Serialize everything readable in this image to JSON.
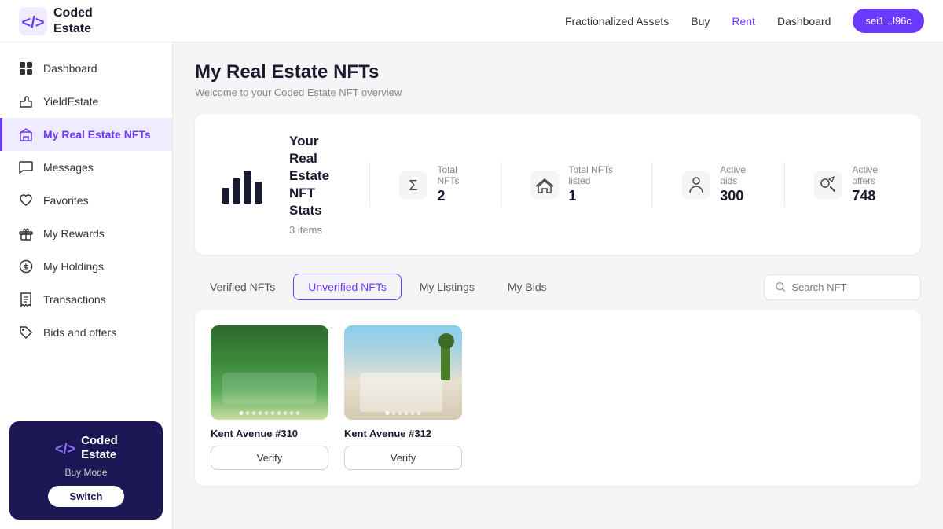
{
  "topnav": {
    "logo_text": "Coded\nEstate",
    "links": [
      {
        "label": "Fractionalized Assets",
        "active": false
      },
      {
        "label": "Buy",
        "active": false
      },
      {
        "label": "Rent",
        "active": true
      },
      {
        "label": "Dashboard",
        "active": false
      }
    ],
    "wallet": "sei1...l96c"
  },
  "sidebar": {
    "items": [
      {
        "id": "dashboard",
        "label": "Dashboard",
        "icon": "grid"
      },
      {
        "id": "yieldestate",
        "label": "YieldEstate",
        "icon": "puzzle"
      },
      {
        "id": "my-nfts",
        "label": "My Real Estate NFTs",
        "icon": "building",
        "active": true
      },
      {
        "id": "messages",
        "label": "Messages",
        "icon": "chat"
      },
      {
        "id": "favorites",
        "label": "Favorites",
        "icon": "heart"
      },
      {
        "id": "rewards",
        "label": "My Rewards",
        "icon": "gift"
      },
      {
        "id": "holdings",
        "label": "My Holdings",
        "icon": "dollar"
      },
      {
        "id": "transactions",
        "label": "Transactions",
        "icon": "receipt"
      },
      {
        "id": "bids",
        "label": "Bids and offers",
        "icon": "tag"
      }
    ],
    "bottom": {
      "logo_text": "Coded\nEstate",
      "mode": "Buy Mode",
      "switch_label": "Switch"
    }
  },
  "main": {
    "page_title": "My Real Estate NFTs",
    "page_subtitle": "Welcome to your Coded Estate NFT overview",
    "stats_card": {
      "title_line1": "Your Real",
      "title_line2": "Estate NFT",
      "title_line3": "Stats",
      "items_label": "3 items",
      "stats": [
        {
          "label": "Total NFTs",
          "value": "2"
        },
        {
          "label": "Total NFTs listed",
          "value": "1"
        },
        {
          "label": "Active bids",
          "value": "300"
        },
        {
          "label": "Active offers",
          "value": "748"
        }
      ]
    },
    "tabs": [
      {
        "label": "Verified NFTs",
        "active": false
      },
      {
        "label": "Unverified NFTs",
        "active": true
      },
      {
        "label": "My Listings",
        "active": false
      },
      {
        "label": "My Bids",
        "active": false
      }
    ],
    "search_placeholder": "Search NFT",
    "nfts": [
      {
        "name": "Kent Avenue #310",
        "verify_label": "Verify",
        "dots": 10,
        "active_dot": 0
      },
      {
        "name": "Kent Avenue #312",
        "verify_label": "Verify",
        "dots": 6,
        "active_dot": 0
      }
    ]
  }
}
